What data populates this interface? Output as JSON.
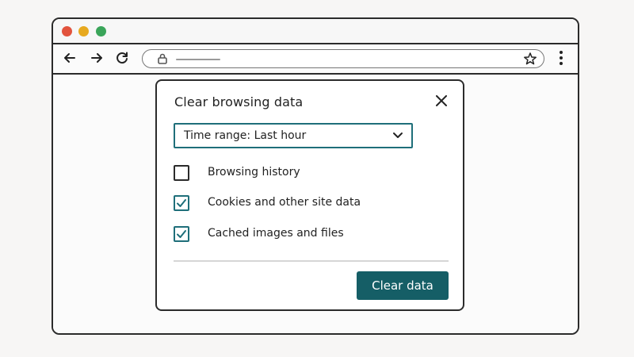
{
  "browser": {
    "traffic_lights": [
      "#e2533d",
      "#e7a91f",
      "#3aa55a"
    ],
    "icons": {
      "back": "arrow-left-icon",
      "forward": "arrow-right-icon",
      "reload": "reload-icon",
      "lock": "lock-icon",
      "bookmark": "star-icon",
      "menu": "kebab-menu-icon"
    }
  },
  "dialog": {
    "title": "Clear browsing data",
    "close_icon": "close-icon",
    "time_range": {
      "label": "Time range: Last hour",
      "chevron_icon": "chevron-down-icon"
    },
    "options": [
      {
        "label": "Browsing history",
        "checked": false
      },
      {
        "label": "Cookies and other site data",
        "checked": true
      },
      {
        "label": "Cached images and files",
        "checked": true
      }
    ],
    "primary_button": "Clear data",
    "accent_color": "#155e66"
  }
}
